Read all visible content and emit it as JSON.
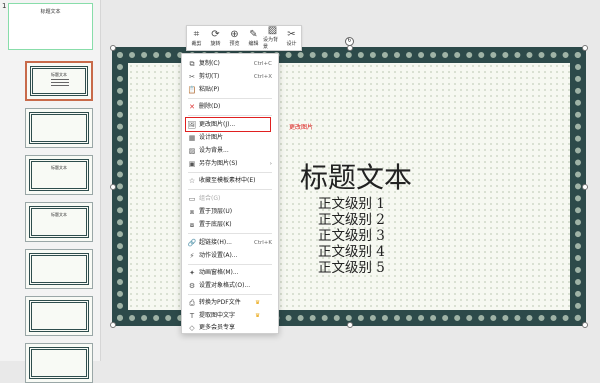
{
  "thumbs": {
    "slide_number": "1"
  },
  "toolbar": {
    "crop": "裁剪",
    "rotate": "旋转",
    "preview": "预览",
    "edit": "编辑",
    "set_background": "设为背景",
    "design": "设计"
  },
  "menu": {
    "copy": "复制(C)",
    "copy_sc": "Ctrl+C",
    "cut": "剪切(T)",
    "cut_sc": "Ctrl+X",
    "paste": "粘贴(P)",
    "delete": "删除(D)",
    "change_picture": "更改图片(J)...",
    "design_picture": "设计图片",
    "set_background": "设为背景...",
    "save_as_picture": "另存为图片(S)",
    "collect": "收藏至模板素材中(E)",
    "group": "组合(G)",
    "bring_front": "置于顶层(U)",
    "send_back": "置于底层(K)",
    "hyperlink": "超链接(H)...",
    "hyperlink_sc": "Ctrl+K",
    "action_settings": "动作设置(A)...",
    "animation": "动画窗格(M)...",
    "format_object": "设置对象格式(O)...",
    "convert_pdf": "转换为PDF文件",
    "extract_text": "提取图中文字",
    "more_vip": "更多会员专享"
  },
  "annotation": "更改图片",
  "slide": {
    "title": "标题文本",
    "levels": [
      "正文级别 1",
      "正文级别 2",
      "正文级别 3",
      "正文级别 4",
      "正文级别 5"
    ]
  },
  "thumbnail_title": "标题文本",
  "colors": {
    "border": "#2d4a4a",
    "highlight": "#e02020",
    "active_thumb": "#c86a4a"
  }
}
